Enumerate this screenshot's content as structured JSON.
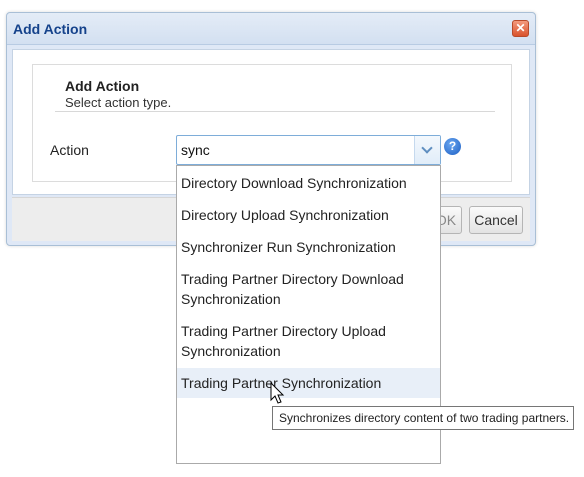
{
  "dialog": {
    "title": "Add Action",
    "close_glyph": "✕",
    "header": {
      "title": "Add Action",
      "subtitle": "Select action type."
    },
    "action_label": "Action",
    "action_value": "sync",
    "help_glyph": "?",
    "buttons": {
      "ok": "OK",
      "cancel": "Cancel"
    }
  },
  "dropdown": {
    "options": [
      "Directory Download Synchronization",
      "Directory Upload Synchronization",
      "Synchronizer Run Synchronization",
      "Trading Partner Directory Download Synchronization",
      "Trading Partner Directory Upload Synchronization",
      "Trading Partner Synchronization"
    ],
    "hovered": "Trading Partner Synchronization"
  },
  "tooltip": "Synchronizes directory content of two trading partners.",
  "icons": {
    "close": "close-icon",
    "help": "help-icon",
    "dropdown": "chevron-down-icon",
    "cursor": "mouse-pointer-icon"
  },
  "colors": {
    "title_text": "#15428b",
    "close_button": "#d9532d",
    "hover_row": "#e8eff8",
    "combo_border": "#7eadd9"
  }
}
